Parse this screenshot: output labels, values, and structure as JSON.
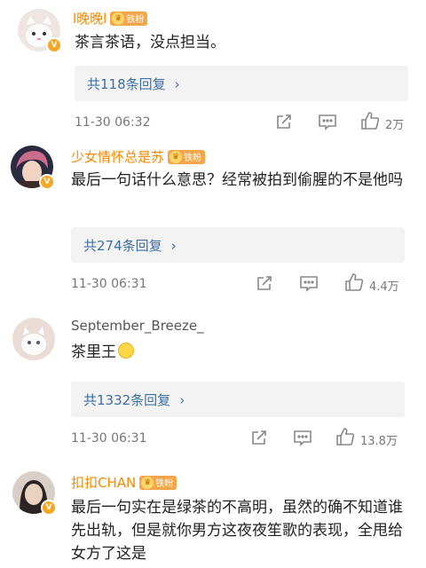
{
  "comments": [
    {
      "username": "l晚晚l",
      "fan_badge": "铁粉",
      "text": "茶言茶语，没点担当。",
      "reply_summary": "共118条回复",
      "timestamp": "11-30 06:32",
      "likes": "2万"
    },
    {
      "username": "少女情怀总是苏",
      "fan_badge": "铁粉",
      "text": "最后一句话什么意思？经常被拍到偷腥的不是他吗",
      "reply_summary": "共274条回复",
      "timestamp": "11-30 06:31",
      "likes": "4.4万"
    },
    {
      "username": "September_Breeze_",
      "text": "茶里王",
      "reply_summary": "共1332条回复",
      "timestamp": "11-30 06:31",
      "likes": "13.8万"
    },
    {
      "username": "扣扣CHAN",
      "fan_badge": "铁粉",
      "text": "最后一句实在是绿茶的不高明，虽然的确不知道谁先出轨，但是就你男方这夜夜笙歌的表现，全甩给女方了这是"
    }
  ],
  "icons": {
    "reply_chevron": "chevron-right-icon",
    "share": "share-icon",
    "comment": "comment-icon",
    "like": "thumbs-up-icon",
    "verified": "verified-badge-icon",
    "fan": "crown-icon",
    "emoji": "emoji-icon"
  },
  "colors": {
    "username_highlight": "#f08a00",
    "reply_link": "#3d6fa6",
    "verified_badge": "#f5a623",
    "fan_badge": "#f3a64a"
  }
}
